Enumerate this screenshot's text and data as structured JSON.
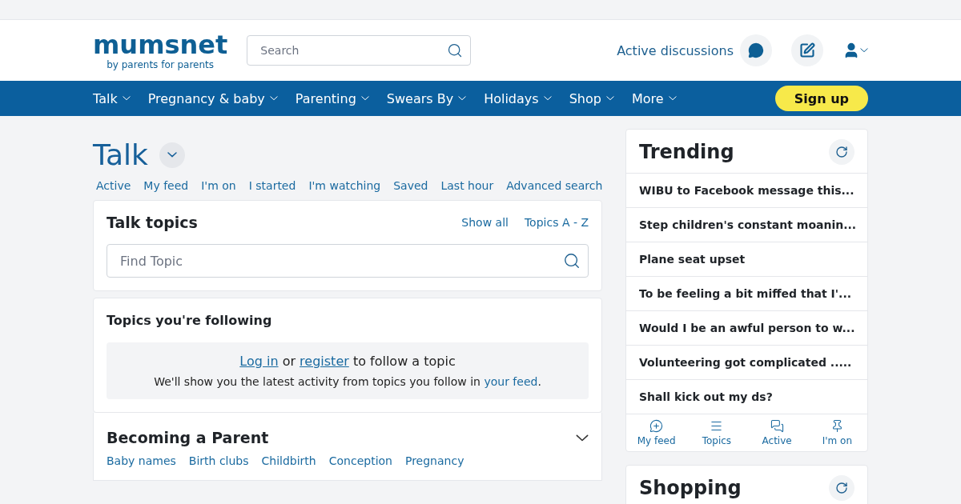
{
  "header": {
    "logo": {
      "name": "mumsnet",
      "tagline": "by parents for parents"
    },
    "search": {
      "placeholder": "Search"
    },
    "active_discussions": "Active discussions"
  },
  "nav": {
    "items": [
      {
        "label": "Talk"
      },
      {
        "label": "Pregnancy & baby"
      },
      {
        "label": "Parenting"
      },
      {
        "label": "Swears By"
      },
      {
        "label": "Holidays"
      },
      {
        "label": "Shop"
      },
      {
        "label": "More"
      }
    ],
    "signup": "Sign up"
  },
  "page": {
    "title": "Talk",
    "links": [
      "Active",
      "My feed",
      "I'm on",
      "I started",
      "I'm watching",
      "Saved",
      "Last hour",
      "Advanced search"
    ]
  },
  "talk_topics": {
    "title": "Talk topics",
    "links": [
      "Show all",
      "Topics A - Z"
    ],
    "search": {
      "placeholder": "Find Topic"
    }
  },
  "following": {
    "title": "Topics you're following",
    "prompt": {
      "login": "Log in",
      "or": "or",
      "register": "register",
      "tail": "to follow a topic"
    },
    "note": {
      "text": "We'll show you the latest activity from topics you follow in",
      "link": "your feed",
      "end": "."
    }
  },
  "section": {
    "title": "Becoming a Parent",
    "expanded": false,
    "links": [
      "Baby names",
      "Birth clubs",
      "Childbirth",
      "Conception",
      "Pregnancy"
    ]
  },
  "trending": {
    "title": "Trending",
    "items": [
      "WIBU to Facebook message this...",
      "Step children's constant moanin...",
      "Plane seat upset",
      "To be feeling a bit miffed that I'...",
      "Would I be an awful person to w...",
      "Volunteering got complicated .....",
      "Shall kick out my ds?"
    ],
    "tabs": [
      {
        "kind": "feed",
        "label": "My feed"
      },
      {
        "kind": "topics",
        "label": "Topics"
      },
      {
        "kind": "active",
        "label": "Active"
      },
      {
        "kind": "pin",
        "label": "I'm on"
      }
    ]
  },
  "next_card": {
    "title": "Shopping"
  }
}
